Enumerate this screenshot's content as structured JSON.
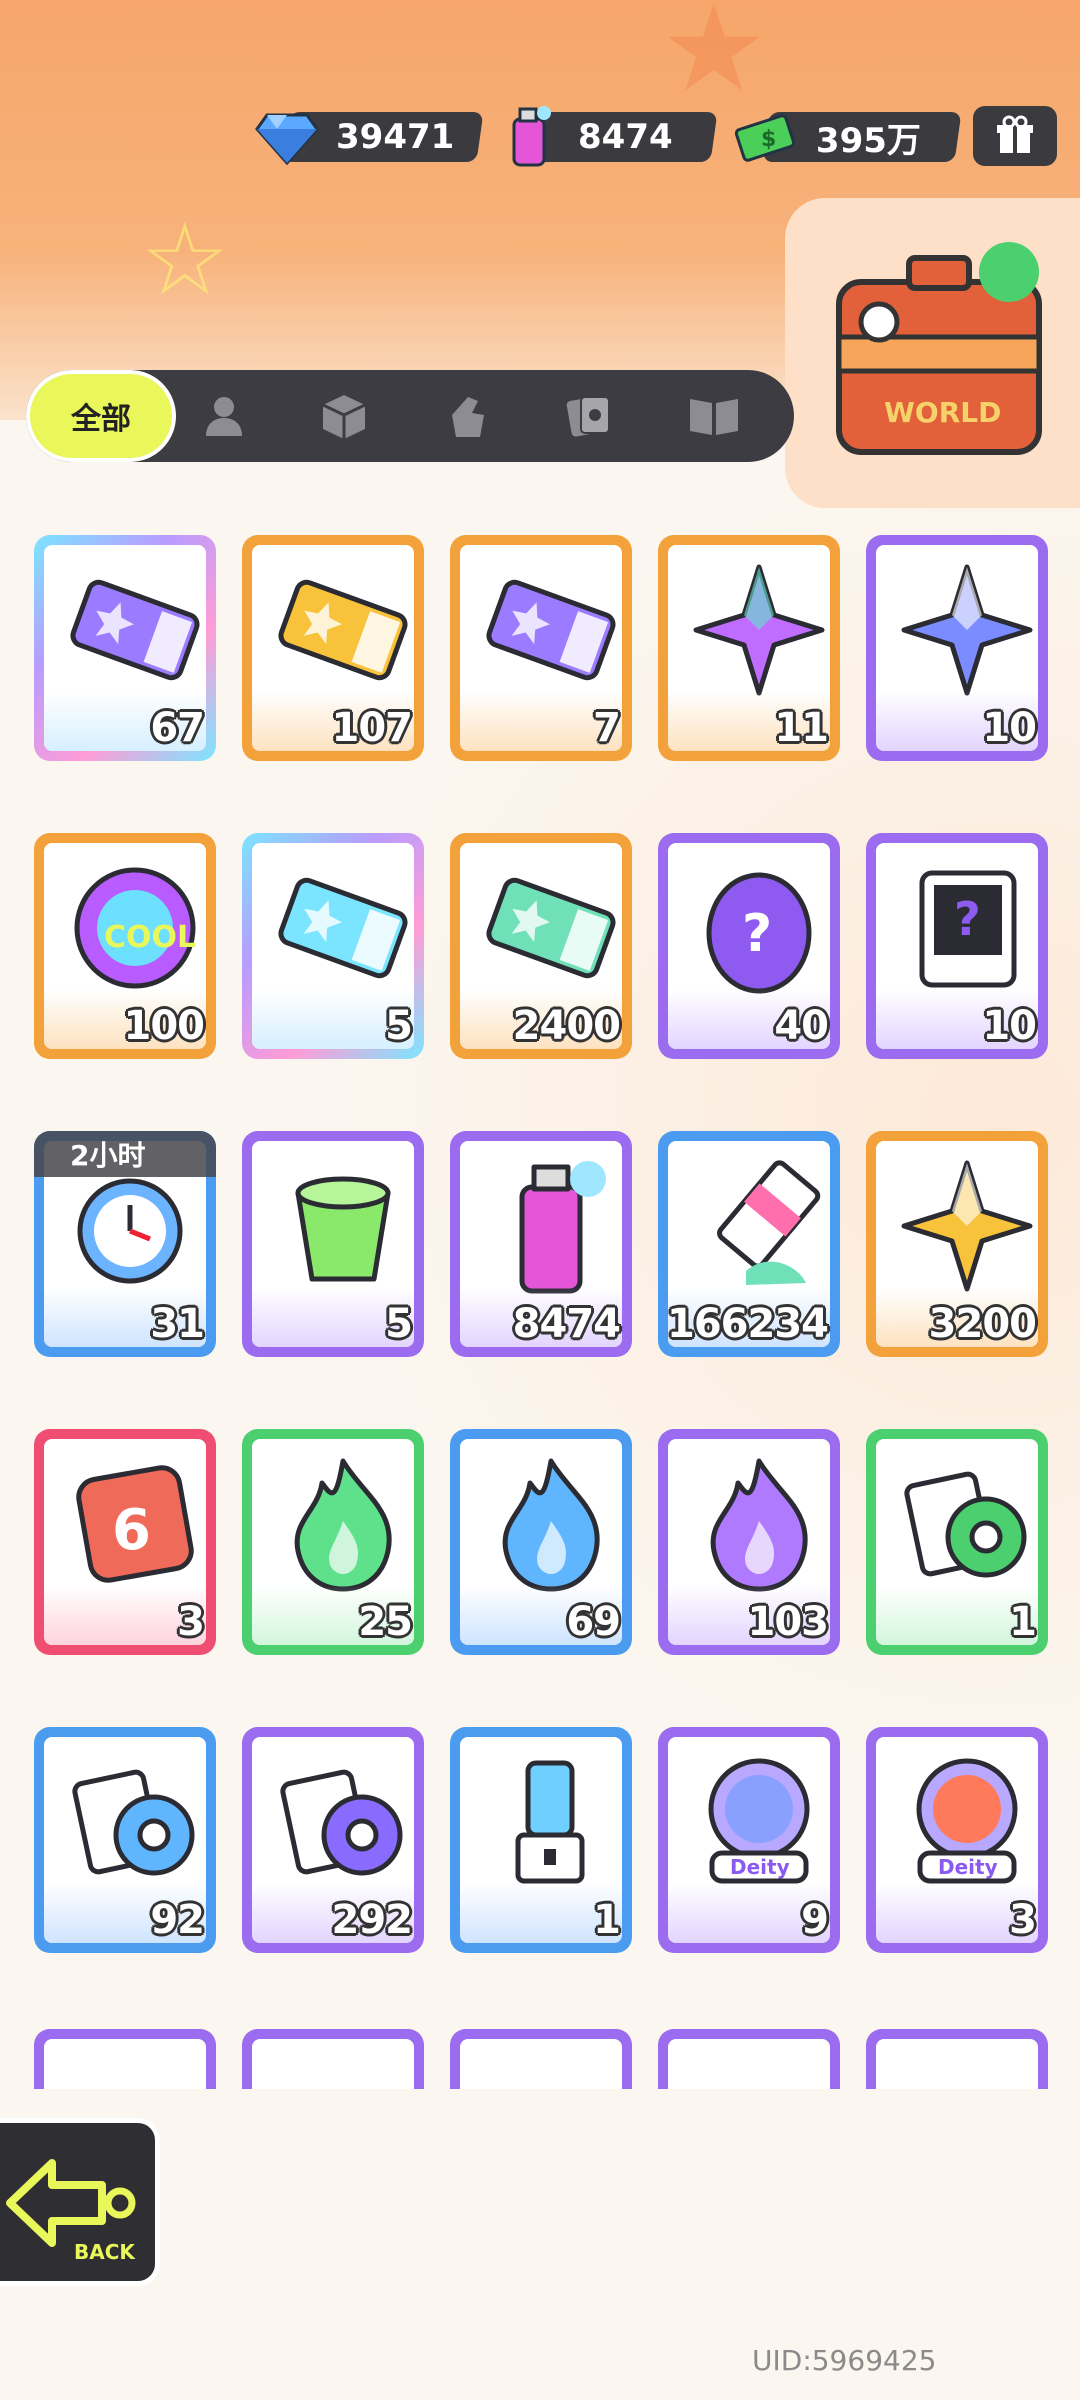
{
  "currencies": [
    {
      "name": "diamond-icon",
      "value": "39471",
      "color": "#5aa8ff"
    },
    {
      "name": "spray-can-icon",
      "value": "8474",
      "color": "#e455d7"
    },
    {
      "name": "cash-icon",
      "value": "395万",
      "color": "#4ccf58"
    }
  ],
  "tabs": {
    "all_label": "全部",
    "icons": [
      "person-icon",
      "box-icon",
      "glove-icon",
      "cards-icon",
      "book-icon"
    ]
  },
  "travel": {
    "label": "WORLD"
  },
  "items": [
    {
      "name": "purple-crown-ticket",
      "count": "67",
      "rarity": "rainbow"
    },
    {
      "name": "gold-star-ticket",
      "count": "107",
      "rarity": "orange"
    },
    {
      "name": "purple-star-ticket",
      "count": "7",
      "rarity": "orange"
    },
    {
      "name": "rainbow-star-crystal",
      "count": "11",
      "rarity": "orange"
    },
    {
      "name": "blue-star-crystal",
      "count": "10",
      "rarity": "purple"
    },
    {
      "name": "cool-badge",
      "count": "100",
      "rarity": "orange"
    },
    {
      "name": "lottery-ticket",
      "count": "5",
      "rarity": "rainbow"
    },
    {
      "name": "season-ticket",
      "count": "2400",
      "rarity": "orange"
    },
    {
      "name": "mystery-egg",
      "count": "40",
      "rarity": "purple"
    },
    {
      "name": "mystery-travel-card",
      "count": "10",
      "rarity": "purple"
    },
    {
      "name": "alarm-clock",
      "count": "31",
      "rarity": "blue",
      "timer": "2小时"
    },
    {
      "name": "green-potion-cup",
      "count": "5",
      "rarity": "purple"
    },
    {
      "name": "spray-can",
      "count": "8474",
      "rarity": "purple"
    },
    {
      "name": "paint-tube",
      "count": "166234",
      "rarity": "blue"
    },
    {
      "name": "gold-crystal",
      "count": "3200",
      "rarity": "orange"
    },
    {
      "name": "red-dice",
      "count": "3",
      "rarity": "red"
    },
    {
      "name": "green-flame",
      "count": "25",
      "rarity": "green"
    },
    {
      "name": "blue-flame",
      "count": "69",
      "rarity": "blue"
    },
    {
      "name": "purple-flame",
      "count": "103",
      "rarity": "purple"
    },
    {
      "name": "green-card-roll",
      "count": "1",
      "rarity": "green"
    },
    {
      "name": "blue-card-roll",
      "count": "92",
      "rarity": "blue"
    },
    {
      "name": "purple-card-roll",
      "count": "292",
      "rarity": "purple"
    },
    {
      "name": "usb-key",
      "count": "1",
      "rarity": "blue"
    },
    {
      "name": "deity-avatar-purple",
      "count": "9",
      "rarity": "purple",
      "badge": "Deity"
    },
    {
      "name": "deity-avatar-red",
      "count": "3",
      "rarity": "purple",
      "badge": "Deity"
    }
  ],
  "partial_row_rarities": [
    "purple",
    "purple",
    "purple",
    "purple",
    "purple"
  ],
  "back_label": "BACK",
  "uid": "UID:5969425",
  "rarity_colors": {
    "orange": "#f3a23b",
    "purple": "#9b6bf0",
    "blue": "#4b9bf0",
    "green": "#4ccf6e",
    "red": "#ef4e72",
    "rainbow": "#7cd0ff"
  }
}
